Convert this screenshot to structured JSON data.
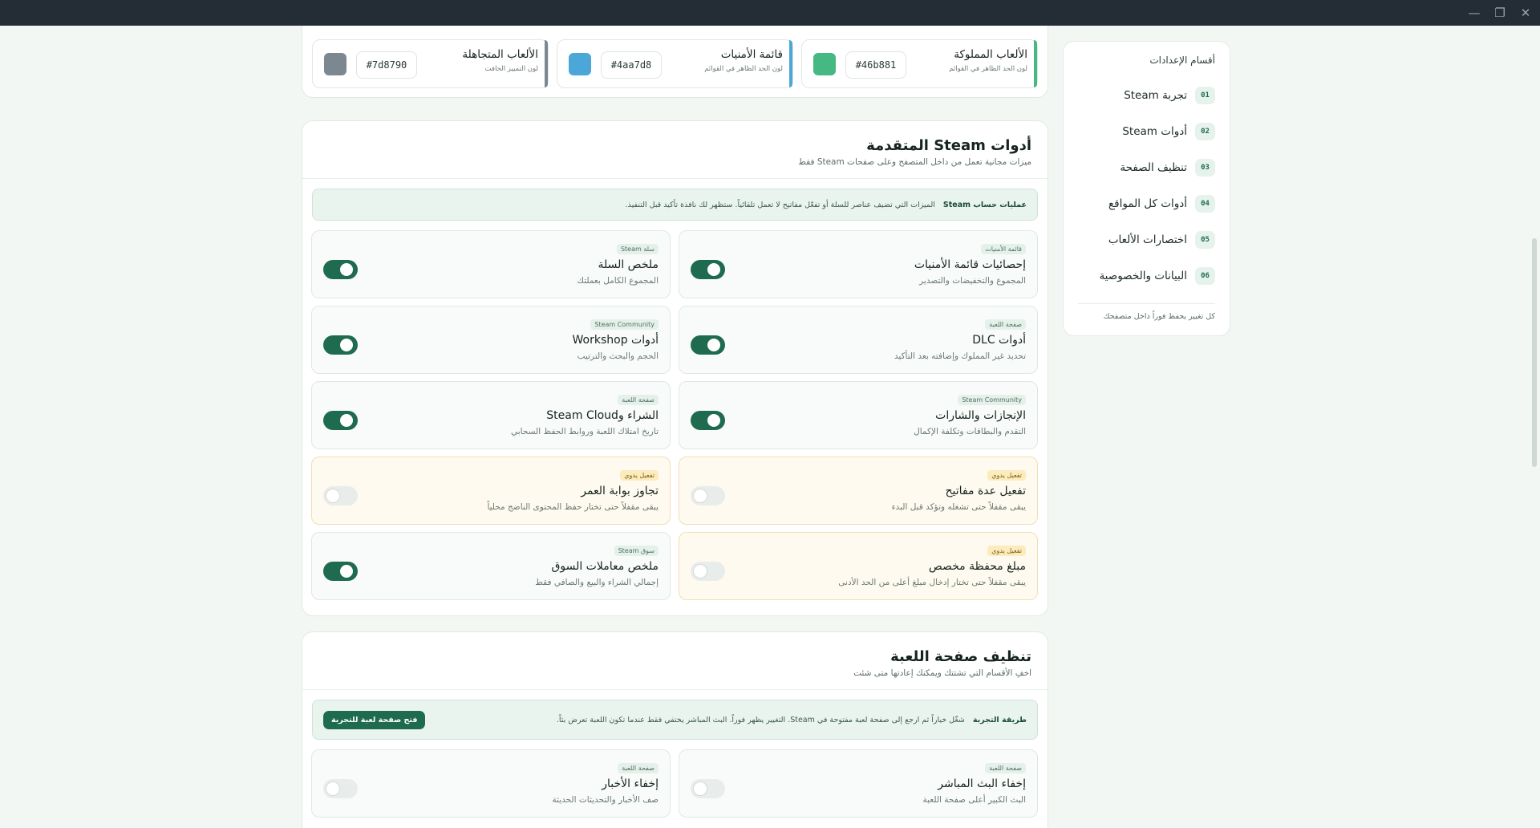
{
  "sidebar": {
    "heading": "أقسام الإعدادات",
    "items": [
      {
        "num": "01",
        "label": "تجربة Steam"
      },
      {
        "num": "02",
        "label": "أدوات Steam"
      },
      {
        "num": "03",
        "label": "تنظيف الصفحة"
      },
      {
        "num": "04",
        "label": "أدوات كل المواقع"
      },
      {
        "num": "05",
        "label": "اختصارات الألعاب"
      },
      {
        "num": "06",
        "label": "البيانات والخصوصية"
      }
    ],
    "footer": "كل تغيير يحفظ فوراً داخل متصفحك"
  },
  "colors": [
    {
      "name": "الألعاب المملوكة",
      "desc": "لون الحد الظاهر في القوائم",
      "hex": "#46b881"
    },
    {
      "name": "قائمة الأمنيات",
      "desc": "لون الحد الظاهر في القوائم",
      "hex": "#4aa7d8"
    },
    {
      "name": "الألعاب المتجاهلة",
      "desc": "لون التمييز الخافت",
      "hex": "#7d8790"
    }
  ],
  "tools": {
    "title": "أدوات Steam المتقدمة",
    "subtitle": "ميزات مجانية تعمل من داخل المتصفح وعلى صفحات Steam فقط",
    "notice_title": "عمليات حساب Steam",
    "notice_text": "الميزات التي تضيف عناصر للسلة أو تفعّل مفاتيح لا تعمل تلقائياً. ستظهر لك نافذة تأكيد قبل التنفيذ.",
    "items": [
      {
        "tag": "قائمة الأمنيات",
        "name": "إحصائيات قائمة الأمنيات",
        "desc": "المجموع والتخفيضات والتصدير",
        "on": true,
        "manual": false
      },
      {
        "tag": "سلة Steam",
        "name": "ملخص السلة",
        "desc": "المجموع الكامل بعملتك",
        "on": true,
        "manual": false
      },
      {
        "tag": "صفحة اللعبة",
        "name": "أدوات DLC",
        "desc": "تحديد غير المملوك وإضافته بعد التأكيد",
        "on": true,
        "manual": false
      },
      {
        "tag": "Steam Community",
        "name": "أدوات Workshop",
        "desc": "الحجم والبحث والترتيب",
        "on": true,
        "manual": false
      },
      {
        "tag": "Steam Community",
        "name": "الإنجازات والشارات",
        "desc": "التقدم والبطاقات وتكلفة الإكمال",
        "on": true,
        "manual": false
      },
      {
        "tag": "صفحة اللعبة",
        "name": "الشراء وSteam Cloud",
        "desc": "تاريخ امتلاك اللعبة وروابط الحفظ السحابي",
        "on": true,
        "manual": false
      },
      {
        "tag": "تفعيل يدوي",
        "name": "تفعيل عدة مفاتيح",
        "desc": "يبقى مقفلاً حتى تشغله وتؤكد قبل البدء",
        "on": false,
        "manual": true
      },
      {
        "tag": "تفعيل يدوي",
        "name": "تجاوز بوابة العمر",
        "desc": "يبقى مقفلاً حتى تختار حفظ المحتوى الناضج محلياً",
        "on": false,
        "manual": true
      },
      {
        "tag": "تفعيل يدوي",
        "name": "مبلغ محفظة مخصص",
        "desc": "يبقى مقفلاً حتى تختار إدخال مبلغ أعلى من الحد الأدنى",
        "on": false,
        "manual": true
      },
      {
        "tag": "سوق Steam",
        "name": "ملخص معاملات السوق",
        "desc": "إجمالي الشراء والبيع والصافي فقط",
        "on": true,
        "manual": false
      }
    ]
  },
  "cleanup": {
    "title": "تنظيف صفحة اللعبة",
    "subtitle": "اخفِ الأقسام التي تشتتك ويمكنك إعادتها متى شئت",
    "notice_title": "طريقة التجربة",
    "notice_text": "شغّل خياراً ثم ارجع إلى صفحة لعبة مفتوحة في Steam. التغيير يظهر فوراً. البث المباشر يختفي فقط عندما تكون اللعبة تعرض بثاً.",
    "notice_button": "فتح صفحة لعبة للتجربة",
    "items": [
      {
        "tag": "صفحة اللعبة",
        "name": "إخفاء البث المباشر",
        "desc": "البث الكبير أعلى صفحة اللعبة",
        "on": false,
        "manual": false
      },
      {
        "tag": "صفحة اللعبة",
        "name": "إخفاء الأخبار",
        "desc": "صف الأخبار والتحديثات الحديثة",
        "on": false,
        "manual": false
      }
    ]
  },
  "window": {
    "minimize": "—",
    "maximize": "❐",
    "close": "✕"
  }
}
